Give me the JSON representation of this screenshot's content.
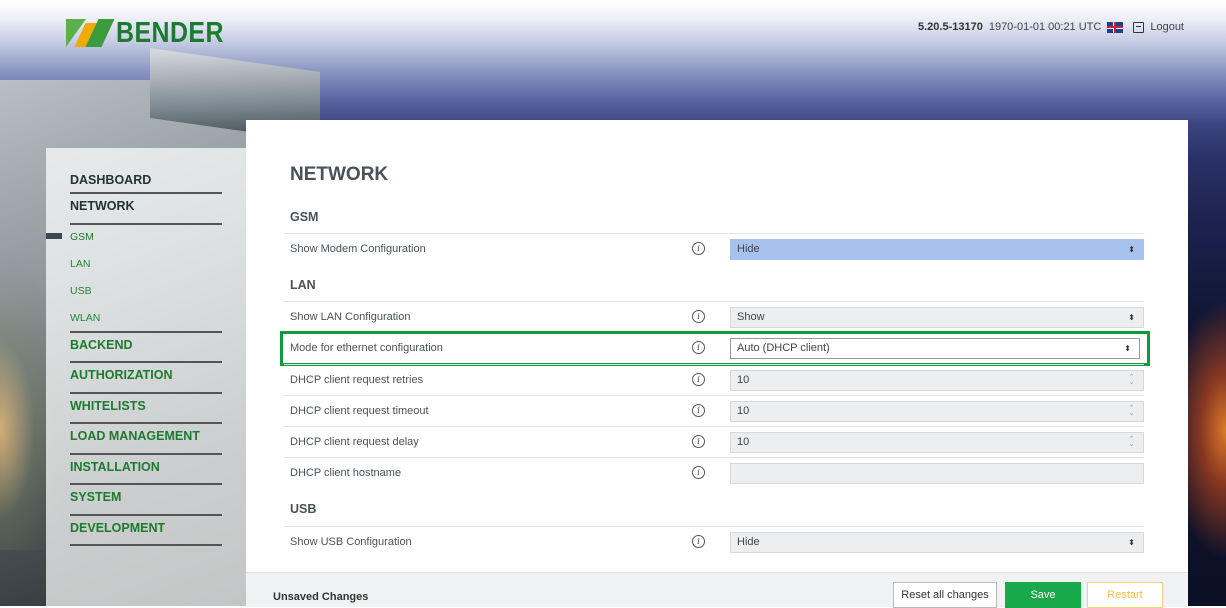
{
  "header": {
    "brand": "BENDER",
    "version": "5.20.5-13170",
    "datetime": "1970-01-01 00:21 UTC",
    "logout_label": "Logout",
    "language_icon": "uk-flag-icon",
    "logout_icon": "logout-icon"
  },
  "sidebar": {
    "items": [
      {
        "label": "DASHBOARD"
      },
      {
        "label": "NETWORK"
      },
      {
        "label": "GSM"
      },
      {
        "label": "LAN"
      },
      {
        "label": "USB"
      },
      {
        "label": "WLAN"
      },
      {
        "label": "BACKEND"
      },
      {
        "label": "AUTHORIZATION"
      },
      {
        "label": "WHITELISTS"
      },
      {
        "label": "LOAD MANAGEMENT"
      },
      {
        "label": "INSTALLATION"
      },
      {
        "label": "SYSTEM"
      },
      {
        "label": "DEVELOPMENT"
      }
    ],
    "active_item": "GSM"
  },
  "main": {
    "title": "NETWORK",
    "sections": {
      "gsm": {
        "title": "GSM"
      },
      "lan": {
        "title": "LAN"
      },
      "usb": {
        "title": "USB"
      }
    },
    "rows": [
      {
        "label": "Show Modem Configuration",
        "value": "Hide"
      },
      {
        "label": "Show LAN Configuration",
        "value": "Show"
      },
      {
        "label": "Mode for ethernet configuration",
        "value": "Auto (DHCP client)"
      },
      {
        "label": "DHCP client request retries",
        "value": "10"
      },
      {
        "label": "DHCP client request timeout",
        "value": "10"
      },
      {
        "label": "DHCP client request delay",
        "value": "10"
      },
      {
        "label": "DHCP client hostname",
        "value": ""
      },
      {
        "label": "Show USB Configuration",
        "value": "Hide"
      }
    ],
    "info_glyph": "i",
    "select_arrow": "⬍",
    "spinner_up": "⌃",
    "spinner_down": "⌄"
  },
  "footer": {
    "status": "Unsaved Changes",
    "reset_label": "Reset all changes",
    "save_label": "Save",
    "restart_label": "Restart"
  },
  "colors": {
    "brand_green": "#1d7a2e",
    "highlight_green": "#0f9a3e",
    "save_green": "#18a94a",
    "select_blue": "#a7c2ec",
    "restart_yellow": "#f0c04a"
  }
}
